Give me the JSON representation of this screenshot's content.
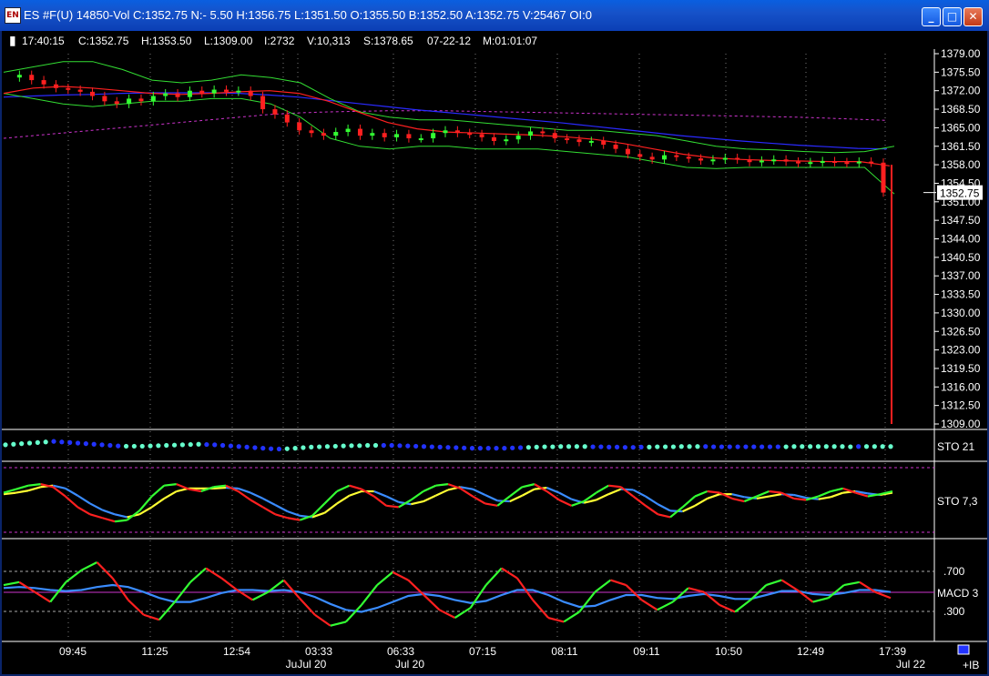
{
  "window": {
    "title": "ES #F(U) 14850-Vol C:1352.75 N:- 5.50 H:1356.75 L:1351.50 O:1355.50 B:1352.50 A:1352.75 V:25467 OI:0",
    "minimize_glyph": "_",
    "maximize_glyph": "□",
    "close_glyph": "✕"
  },
  "info_bar": {
    "time": "17:40:15",
    "close": "C:1352.75",
    "high": "H:1353.50",
    "low": "L:1309.00",
    "index": "I:2732",
    "volume": "V:10,313",
    "s_value": "S:1378.65",
    "date": "07-22-12",
    "m_value": "M:01:01:07"
  },
  "colors": {
    "background": "#000000",
    "bull_candle": "#33ff33",
    "bear_candle": "#ff2020",
    "bollinger": "#33dd33",
    "ma_red": "#ff2020",
    "ma_blue": "#2a2aff",
    "ma_magenta": "#cc33cc",
    "sto_up": "#33ff33",
    "sto_down": "#ff2020",
    "sto_slow": "#ffff33",
    "sto_blue": "#3a8cff",
    "current_price_box": "#ffffff"
  },
  "chart_data": [
    {
      "type": "candlestick",
      "panel": "price",
      "ylim": [
        1309.0,
        1379.0
      ],
      "y_ticks": [
        "1379.00",
        "1375.50",
        "1372.00",
        "1368.50",
        "1365.00",
        "1361.50",
        "1358.00",
        "1354.50",
        "1351.00",
        "1347.50",
        "1344.00",
        "1340.50",
        "1337.00",
        "1333.50",
        "1330.00",
        "1326.50",
        "1323.00",
        "1319.50",
        "1316.00",
        "1312.50",
        "1309.00"
      ],
      "current_price": "1352.75",
      "x_tick_labels": [
        "09:45",
        "11:25",
        "12:54",
        "03:33",
        "06:33",
        "07:15",
        "08:11",
        "09:11",
        "10:50",
        "12:49",
        "17:39"
      ],
      "date_labels": [
        "JuJul 20",
        "Jul 20",
        "Jul 22"
      ],
      "close_path": [
        1374.5,
        1375.0,
        1374.0,
        1373.2,
        1372.5,
        1372.2,
        1371.8,
        1371.0,
        1370.0,
        1369.5,
        1370.5,
        1370.0,
        1371.0,
        1371.5,
        1370.8,
        1372.0,
        1371.5,
        1372.2,
        1371.8,
        1372.0,
        1371.0,
        1368.5,
        1367.5,
        1366.0,
        1364.5,
        1364.0,
        1363.5,
        1364.2,
        1364.8,
        1363.5,
        1364.0,
        1363.2,
        1363.8,
        1363.0,
        1363.0,
        1364.0,
        1364.5,
        1364.0,
        1363.8,
        1363.2,
        1362.5,
        1362.8,
        1363.5,
        1364.3,
        1364.0,
        1363.0,
        1362.8,
        1362.3,
        1362.5,
        1361.8,
        1361.0,
        1360.0,
        1359.5,
        1359.0,
        1359.8,
        1359.5,
        1359.2,
        1358.8,
        1359.0,
        1359.3,
        1359.0,
        1358.5,
        1358.8,
        1359.0,
        1358.6,
        1358.3,
        1358.5,
        1358.7,
        1358.5,
        1358.3,
        1358.6,
        1358.4,
        1352.75
      ],
      "bollinger_upper": [
        1375.5,
        1376.5,
        1377.5,
        1377.5,
        1376.0,
        1374.0,
        1373.5,
        1374.0,
        1375.0,
        1374.5,
        1373.5,
        1370.5,
        1368.0,
        1367.0,
        1366.5,
        1366.5,
        1366.0,
        1365.5,
        1365.0,
        1364.5,
        1364.5,
        1364.0,
        1363.5,
        1362.5,
        1361.5,
        1361.0,
        1360.8,
        1360.5,
        1360.3,
        1360.5,
        1361.5
      ],
      "bollinger_lower": [
        1371.5,
        1370.5,
        1369.5,
        1369.0,
        1369.5,
        1370.0,
        1370.0,
        1370.5,
        1370.5,
        1369.5,
        1367.0,
        1363.0,
        1361.5,
        1361.0,
        1361.5,
        1361.5,
        1361.0,
        1361.0,
        1361.0,
        1360.5,
        1360.0,
        1359.5,
        1358.5,
        1357.5,
        1357.3,
        1357.5,
        1357.5,
        1357.5,
        1357.5,
        1357.5,
        1352.5
      ],
      "ma_red": [
        1371.5,
        1372.5,
        1372.8,
        1372.5,
        1372.0,
        1371.5,
        1371.3,
        1371.5,
        1371.8,
        1372.0,
        1371.5,
        1370.0,
        1368.0,
        1366.0,
        1364.8,
        1364.2,
        1364.0,
        1363.8,
        1363.6,
        1363.3,
        1362.8,
        1362.0,
        1361.0,
        1360.0,
        1359.3,
        1359.0,
        1358.8,
        1358.7,
        1358.6,
        1358.6,
        1357.8
      ],
      "ma_blue": [
        1370.8,
        1371.0,
        1371.2,
        1371.3,
        1371.5,
        1371.6,
        1371.6,
        1371.6,
        1371.5,
        1371.2,
        1370.8,
        1370.2,
        1369.6,
        1369.0,
        1368.4,
        1367.9,
        1367.4,
        1366.9,
        1366.4,
        1365.9,
        1365.3,
        1364.7,
        1364.1,
        1363.5,
        1363.0,
        1362.5,
        1362.1,
        1361.7,
        1361.4,
        1361.1,
        1361.0
      ],
      "ma_magenta": [
        1363.0,
        1363.5,
        1364.0,
        1364.5,
        1365.0,
        1365.5,
        1366.0,
        1366.5,
        1367.0,
        1367.5,
        1367.8,
        1368.0,
        1368.1,
        1368.2,
        1368.2,
        1368.2,
        1368.1,
        1368.0,
        1367.9,
        1367.8,
        1367.7,
        1367.6,
        1367.5,
        1367.4,
        1367.3,
        1367.2,
        1367.1,
        1367.0,
        1366.8,
        1366.6,
        1366.4
      ]
    },
    {
      "type": "dot-line",
      "panel": "STO 21",
      "label": "STO  21",
      "states": [
        "up",
        "up",
        "up",
        "up",
        "up",
        "up",
        "down",
        "down",
        "down",
        "down",
        "down",
        "down",
        "down",
        "down",
        "down",
        "up",
        "up",
        "up",
        "up",
        "up",
        "up",
        "up",
        "up",
        "up",
        "up",
        "down",
        "down",
        "down",
        "down",
        "down",
        "down",
        "down",
        "down",
        "down",
        "down",
        "up",
        "up",
        "up",
        "up",
        "up",
        "up",
        "up",
        "up",
        "up",
        "up",
        "up",
        "up",
        "down",
        "down",
        "down",
        "down",
        "down",
        "down",
        "down",
        "down",
        "down",
        "down",
        "down",
        "down",
        "down",
        "down",
        "down",
        "down",
        "down",
        "down",
        "up",
        "up",
        "up",
        "up",
        "up",
        "up",
        "up",
        "up",
        "down",
        "down",
        "down",
        "down",
        "down",
        "down",
        "down",
        "up",
        "up",
        "up",
        "up",
        "up",
        "up",
        "up",
        "down",
        "down",
        "down",
        "down",
        "down",
        "down",
        "down",
        "down",
        "down",
        "down",
        "up",
        "up",
        "up",
        "up",
        "up",
        "up",
        "up",
        "up",
        "up",
        "down",
        "up",
        "up",
        "up",
        "up",
        "up"
      ],
      "values": [
        0.52,
        0.54,
        0.56,
        0.58,
        0.6,
        0.62,
        0.64,
        0.62,
        0.6,
        0.58,
        0.56,
        0.54,
        0.52,
        0.5,
        0.48,
        0.47,
        0.47,
        0.47,
        0.48,
        0.49,
        0.5,
        0.51,
        0.52,
        0.53,
        0.54,
        0.53,
        0.52,
        0.5,
        0.48,
        0.46,
        0.44,
        0.42,
        0.4,
        0.38,
        0.37,
        0.38,
        0.4,
        0.42,
        0.44,
        0.45,
        0.46,
        0.47,
        0.48,
        0.49,
        0.49,
        0.5,
        0.5,
        0.5,
        0.5,
        0.49,
        0.48,
        0.47,
        0.46,
        0.45,
        0.44,
        0.43,
        0.42,
        0.41,
        0.4,
        0.4,
        0.4,
        0.4,
        0.4,
        0.41,
        0.42,
        0.43,
        0.44,
        0.45,
        0.45,
        0.46,
        0.46,
        0.46,
        0.46,
        0.45,
        0.45,
        0.44,
        0.44,
        0.43,
        0.43,
        0.44,
        0.44,
        0.45,
        0.45,
        0.45,
        0.46,
        0.46,
        0.46,
        0.46,
        0.45,
        0.45,
        0.45,
        0.45,
        0.45,
        0.45,
        0.45,
        0.45,
        0.45,
        0.45,
        0.46,
        0.46,
        0.46,
        0.46,
        0.46,
        0.46,
        0.46,
        0.45,
        0.46,
        0.46,
        0.46,
        0.46,
        0.46
      ]
    },
    {
      "type": "line",
      "panel": "STO 7,3",
      "label": "STO  7,3",
      "ylim": [
        0,
        100
      ],
      "fast": [
        60,
        65,
        70,
        72,
        68,
        55,
        40,
        30,
        25,
        20,
        22,
        35,
        55,
        70,
        72,
        65,
        62,
        68,
        70,
        62,
        50,
        40,
        30,
        25,
        22,
        28,
        45,
        62,
        70,
        65,
        55,
        42,
        40,
        50,
        62,
        70,
        72,
        66,
        55,
        45,
        42,
        55,
        68,
        72,
        62,
        50,
        42,
        48,
        60,
        70,
        68,
        55,
        42,
        30,
        26,
        40,
        55,
        62,
        60,
        52,
        48,
        55,
        62,
        60,
        52,
        50,
        55,
        62,
        66,
        60,
        55,
        58,
        62
      ],
      "slow": [
        58,
        60,
        63,
        68,
        70,
        66,
        56,
        45,
        36,
        30,
        26,
        30,
        40,
        52,
        62,
        66,
        66,
        66,
        67,
        66,
        60,
        52,
        43,
        34,
        28,
        26,
        32,
        45,
        56,
        62,
        62,
        55,
        47,
        44,
        48,
        56,
        64,
        68,
        65,
        57,
        49,
        48,
        56,
        65,
        67,
        60,
        51,
        46,
        50,
        58,
        65,
        64,
        55,
        44,
        35,
        34,
        42,
        52,
        58,
        58,
        54,
        52,
        55,
        58,
        57,
        53,
        51,
        54,
        60,
        62,
        59,
        57,
        60
      ]
    },
    {
      "type": "line",
      "panel": "MACD",
      "label": "MACD  3",
      "y_labels": [
        ".700",
        ".300"
      ],
      "fast": [
        55,
        58,
        48,
        38,
        58,
        70,
        78,
        62,
        40,
        25,
        20,
        38,
        58,
        72,
        62,
        50,
        40,
        48,
        60,
        42,
        25,
        14,
        18,
        35,
        55,
        68,
        60,
        45,
        30,
        22,
        32,
        55,
        72,
        62,
        40,
        22,
        18,
        28,
        48,
        60,
        55,
        40,
        30,
        38,
        52,
        48,
        35,
        28,
        40,
        55,
        60,
        50,
        38,
        42,
        55,
        58,
        48,
        42
      ],
      "slow": [
        52,
        53,
        52,
        50,
        49,
        50,
        53,
        55,
        53,
        48,
        42,
        38,
        38,
        42,
        47,
        50,
        50,
        49,
        50,
        48,
        43,
        36,
        30,
        28,
        32,
        38,
        44,
        46,
        44,
        40,
        37,
        39,
        45,
        50,
        50,
        45,
        38,
        33,
        34,
        40,
        45,
        45,
        42,
        41,
        44,
        46,
        44,
        41,
        41,
        45,
        49,
        49,
        46,
        45,
        47,
        50,
        50,
        48
      ]
    }
  ]
}
